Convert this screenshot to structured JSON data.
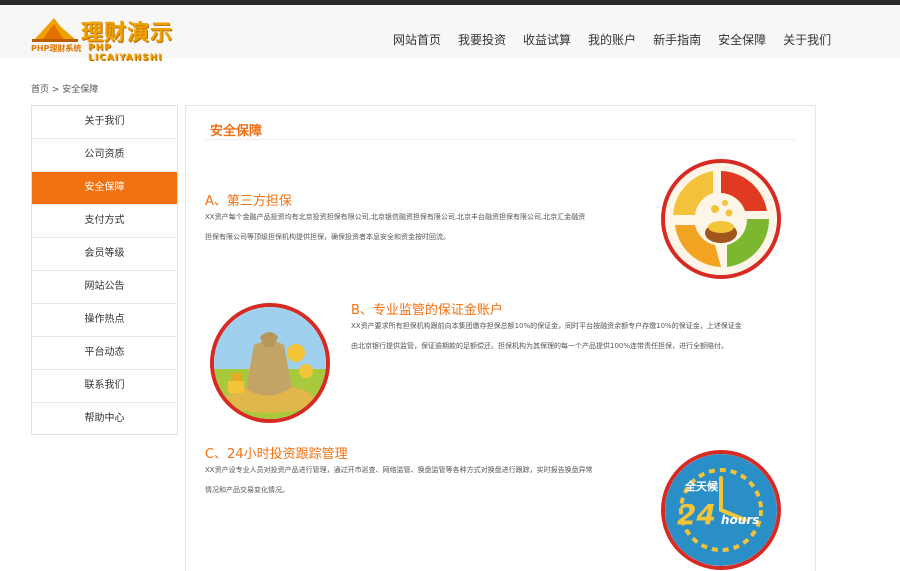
{
  "header": {
    "logo_title": "理财演示",
    "logo_sub": "PHP理财系统",
    "logo_sub_latin": "PHP LICAIYANSHI",
    "nav": [
      "网站首页",
      "我要投资",
      "收益试算",
      "我的账户",
      "新手指南",
      "安全保障",
      "关于我们"
    ]
  },
  "breadcrumb": "首页 > 安全保障",
  "sidebar": {
    "items": [
      "关于我们",
      "公司资质",
      "安全保障",
      "支付方式",
      "会员等级",
      "网站公告",
      "操作热点",
      "平台动态",
      "联系我们",
      "帮助中心"
    ],
    "active_index": 2
  },
  "content": {
    "heading": "安全保障",
    "sections": [
      {
        "title": "A、第三方担保",
        "lines": [
          "XX资产每个金融产品投资均有北京投资担保有限公司,北京银信融资担保有限公司,北京丰台融资担保有限公司,北京汇金融资",
          "担保有限公司等顶级担保机构提供担保，确保投资者本息安全和资金按时回流。"
        ],
        "icon": "money-cycle-icon"
      },
      {
        "title": "B、专业监管的保证金账户",
        "lines": [
          "XX资产要求所有担保机构跟前向本集团缴存担保总额10%的保证金，同时平台按融资余额专户存缴10%的保证金，上述保证金",
          "由北京银行提供监管，保证逾期款的足额偿还。担保机构为其保理的每一个产品提供100%连带责任担保，进行全额赔付。"
        ],
        "icon": "money-bag-icon"
      },
      {
        "title": "C、24小时投资跟踪管理",
        "lines": [
          "XX资产设专业人员对投资产品进行管理，通过开市巡查、网络监管、换盘监管等各种方式对换盘进行跟踪，实时报告换盘异常",
          "情况和产品交易变化情况。"
        ],
        "icon": "clock-24h-icon",
        "badge_top": "全天候",
        "badge_num": "24",
        "badge_unit": "hours"
      }
    ]
  },
  "colors": {
    "accent": "#f07112",
    "ring": "#d62a23"
  }
}
